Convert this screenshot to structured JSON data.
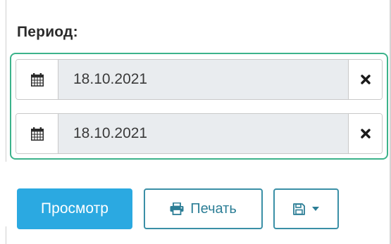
{
  "period": {
    "label": "Период:"
  },
  "date_range": {
    "from": {
      "value": "18.10.2021",
      "calendar_icon": "calendar-icon",
      "clear_icon": "close-icon"
    },
    "to": {
      "value": "18.10.2021",
      "calendar_icon": "calendar-icon",
      "clear_icon": "close-icon"
    }
  },
  "actions": {
    "view_label": "Просмотр",
    "print_label": "Печать",
    "print_icon": "printer-icon",
    "save_icon": "save-icon",
    "save_dropdown_icon": "caret-down-icon"
  },
  "colors": {
    "group_border": "#3cb38b",
    "primary_button": "#2ba9e1",
    "outline_button": "#3a8fa6",
    "input_background": "#e9ecef"
  }
}
